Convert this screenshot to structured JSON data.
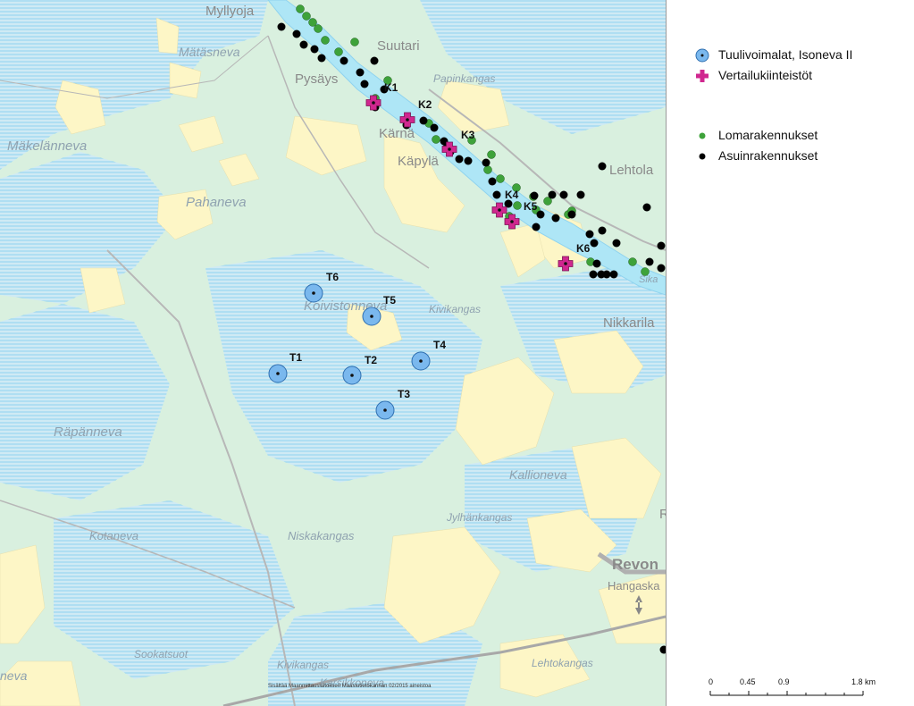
{
  "map": {
    "place_names": [
      {
        "text": "Myllyoja",
        "style": "place",
        "size": 15
      },
      {
        "text": "Mätäsneva",
        "style": "italic",
        "size": 14
      },
      {
        "text": "Suutari",
        "style": "place",
        "size": 15
      },
      {
        "text": "Pysäys",
        "style": "place",
        "size": 15
      },
      {
        "text": "Papinkangas",
        "style": "italic",
        "size": 12
      },
      {
        "text": "Mäkelänneva",
        "style": "italic",
        "size": 15
      },
      {
        "text": "Kärnä",
        "style": "place",
        "size": 15
      },
      {
        "text": "Käpylä",
        "style": "place",
        "size": 15
      },
      {
        "text": "Lehtola",
        "style": "place",
        "size": 15
      },
      {
        "text": "Pahaneva",
        "style": "italic",
        "size": 15
      },
      {
        "text": "Koivistonneva",
        "style": "italic",
        "size": 15
      },
      {
        "text": "Kivikangas",
        "style": "italic",
        "size": 12
      },
      {
        "text": "Nikkarila",
        "style": "place",
        "size": 15
      },
      {
        "text": "Räpänneva",
        "style": "italic",
        "size": 15
      },
      {
        "text": "Kallioneva",
        "style": "italic",
        "size": 14
      },
      {
        "text": "Jylhänkangas",
        "style": "italic",
        "size": 12
      },
      {
        "text": "Kotaneva",
        "style": "italic",
        "size": 13
      },
      {
        "text": "Niskakangas",
        "style": "italic",
        "size": 13
      },
      {
        "text": "Revon",
        "style": "bold",
        "size": 17
      },
      {
        "text": "Hangaska",
        "style": "place",
        "size": 13
      },
      {
        "text": "Sookatsuot",
        "style": "italic",
        "size": 12
      },
      {
        "text": "Kivikangas",
        "style": "italic",
        "size": 12
      },
      {
        "text": "Karsikkoneva",
        "style": "italic",
        "size": 12
      },
      {
        "text": "Lehtokangas",
        "style": "italic",
        "size": 12
      },
      {
        "text": "neva",
        "style": "italic",
        "size": 14
      },
      {
        "text": "Sika",
        "style": "italic",
        "size": 11
      },
      {
        "text": "R",
        "style": "place",
        "size": 15
      }
    ],
    "turbines": [
      "T1",
      "T2",
      "T3",
      "T4",
      "T5",
      "T6"
    ],
    "reference_properties": [
      "K1",
      "K2",
      "K3",
      "K4",
      "K5",
      "K6"
    ],
    "credit": "Sisältää Maanmittauslaitoksen Maastotietokannan 02/2015 aineistoa"
  },
  "legend": {
    "items": [
      {
        "symbol": "turbine-icon",
        "label": "Tuulivoimalat, Isoneva II"
      },
      {
        "symbol": "cross-icon",
        "label": "Vertailukiinteistöt"
      },
      {
        "symbol": "green-dot-icon",
        "label": "Lomarakennukset"
      },
      {
        "symbol": "black-dot-icon",
        "label": "Asuinrakennukset"
      }
    ]
  },
  "scalebar": {
    "labels": [
      "0",
      "0.45",
      "0.9",
      "1.8 km"
    ]
  },
  "colors": {
    "land": "#d9f0df",
    "field": "#fdf6c6",
    "water": "#aee6f6",
    "ditch": "#8fd3ef",
    "turbine": "#7ab8ee",
    "cross": "#d0278f",
    "holiday": "#3ea23a",
    "residential": "#000000"
  }
}
